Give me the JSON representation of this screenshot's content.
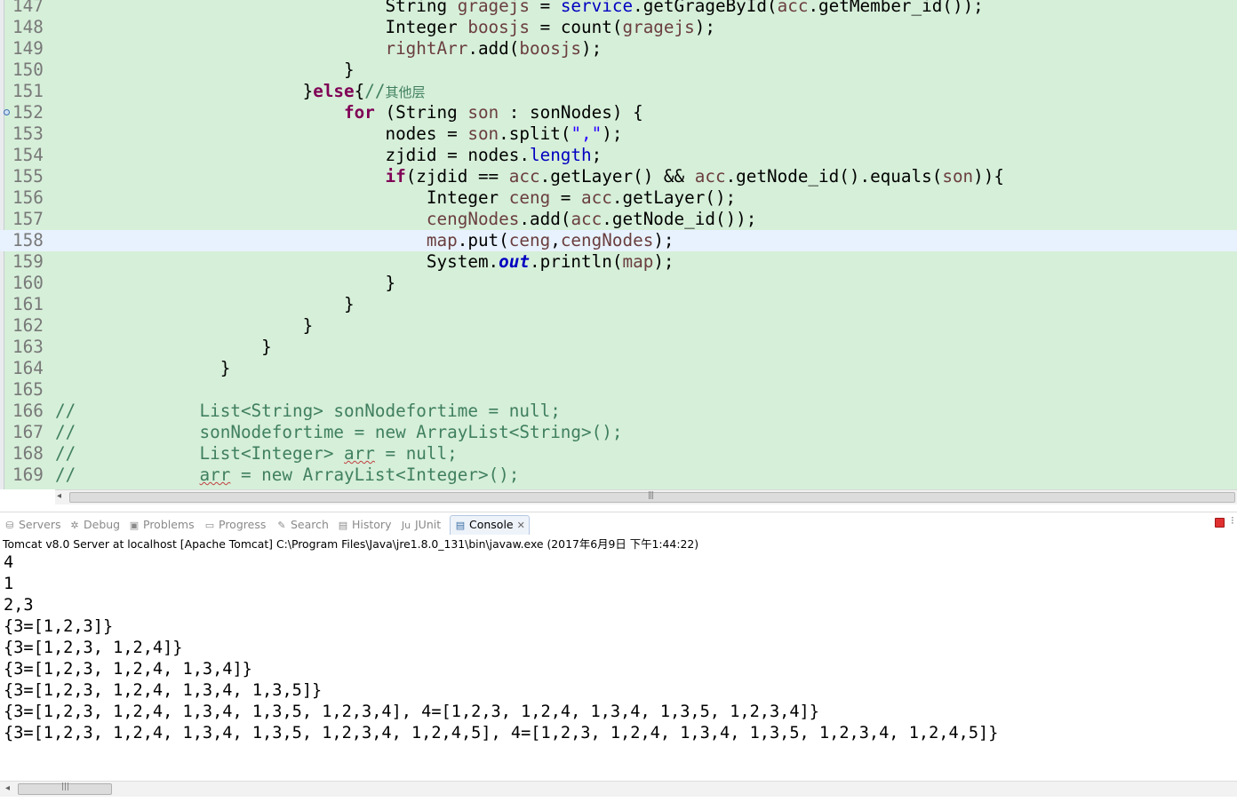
{
  "editor": {
    "lines": [
      {
        "num": "147",
        "text": "                                String gragejs = service.getGrageById(acc.getMember_id());"
      },
      {
        "num": "148",
        "text": "                                Integer boosjs = count(gragejs);"
      },
      {
        "num": "149",
        "text": "                                rightArr.add(boosjs);"
      },
      {
        "num": "150",
        "text": "                            }"
      },
      {
        "num": "151",
        "text": "                        }else{//其他层"
      },
      {
        "num": "152",
        "text": "                            for (String son : sonNodes) {"
      },
      {
        "num": "153",
        "text": "                                nodes = son.split(\",\");"
      },
      {
        "num": "154",
        "text": "                                zjdid = nodes.length;"
      },
      {
        "num": "155",
        "text": "                                if(zjdid == acc.getLayer() && acc.getNode_id().equals(son)){"
      },
      {
        "num": "156",
        "text": "                                    Integer ceng = acc.getLayer();"
      },
      {
        "num": "157",
        "text": "                                    cengNodes.add(acc.getNode_id());"
      },
      {
        "num": "158",
        "text": "                                    map.put(ceng,cengNodes);"
      },
      {
        "num": "159",
        "text": "                                    System.out.println(map);"
      },
      {
        "num": "160",
        "text": "                                }"
      },
      {
        "num": "161",
        "text": "                            }"
      },
      {
        "num": "162",
        "text": "                        }"
      },
      {
        "num": "163",
        "text": "                    }"
      },
      {
        "num": "164",
        "text": "                }"
      },
      {
        "num": "165",
        "text": ""
      },
      {
        "num": "166",
        "text": "//            List<String> sonNodefortime = null;"
      },
      {
        "num": "167",
        "text": "//            sonNodefortime = new ArrayList<String>();"
      },
      {
        "num": "168",
        "text": "//            List<Integer> arr = null;"
      },
      {
        "num": "169",
        "text": "//            arr = new ArrayList<Integer>();"
      }
    ]
  },
  "view_tabs": [
    {
      "label": "Servers",
      "icon": "servers-icon",
      "glyph": "⛁"
    },
    {
      "label": "Debug",
      "icon": "debug-icon",
      "glyph": "✲"
    },
    {
      "label": "Problems",
      "icon": "problems-icon",
      "glyph": "▣"
    },
    {
      "label": "Progress",
      "icon": "progress-icon",
      "glyph": "▭"
    },
    {
      "label": "Search",
      "icon": "search-icon",
      "glyph": "✎"
    },
    {
      "label": "History",
      "icon": "history-icon",
      "glyph": "▤"
    },
    {
      "label": "JUnit",
      "icon": "junit-icon",
      "glyph": "Ju"
    },
    {
      "label": "Console",
      "icon": "console-icon",
      "glyph": "▤",
      "active": true
    }
  ],
  "console": {
    "header": "Tomcat v8.0 Server at localhost [Apache Tomcat] C:\\Program Files\\Java\\jre1.8.0_131\\bin\\javaw.exe (2017年6月9日 下午1:44:22)",
    "output": [
      "4",
      "1",
      "2,3",
      "{3=[1,2,3]}",
      "{3=[1,2,3, 1,2,4]}",
      "{3=[1,2,3, 1,2,4, 1,3,4]}",
      "{3=[1,2,3, 1,2,4, 1,3,4, 1,3,5]}",
      "{3=[1,2,3, 1,2,4, 1,3,4, 1,3,5, 1,2,3,4], 4=[1,2,3, 1,2,4, 1,3,4, 1,3,5, 1,2,3,4]}",
      "{3=[1,2,3, 1,2,4, 1,3,4, 1,3,5, 1,2,3,4, 1,2,4,5], 4=[1,2,3, 1,2,4, 1,3,4, 1,3,5, 1,2,3,4, 1,2,4,5]}"
    ]
  },
  "colors": {
    "editor_bg": "#d6efd9",
    "current_line": "#e8f2fe",
    "keyword": "#7f0055",
    "field": "#0000c0",
    "local_var": "#6a3e3e",
    "string": "#2a00ff",
    "comment": "#3f7f5f",
    "terminate": "#e03030"
  }
}
